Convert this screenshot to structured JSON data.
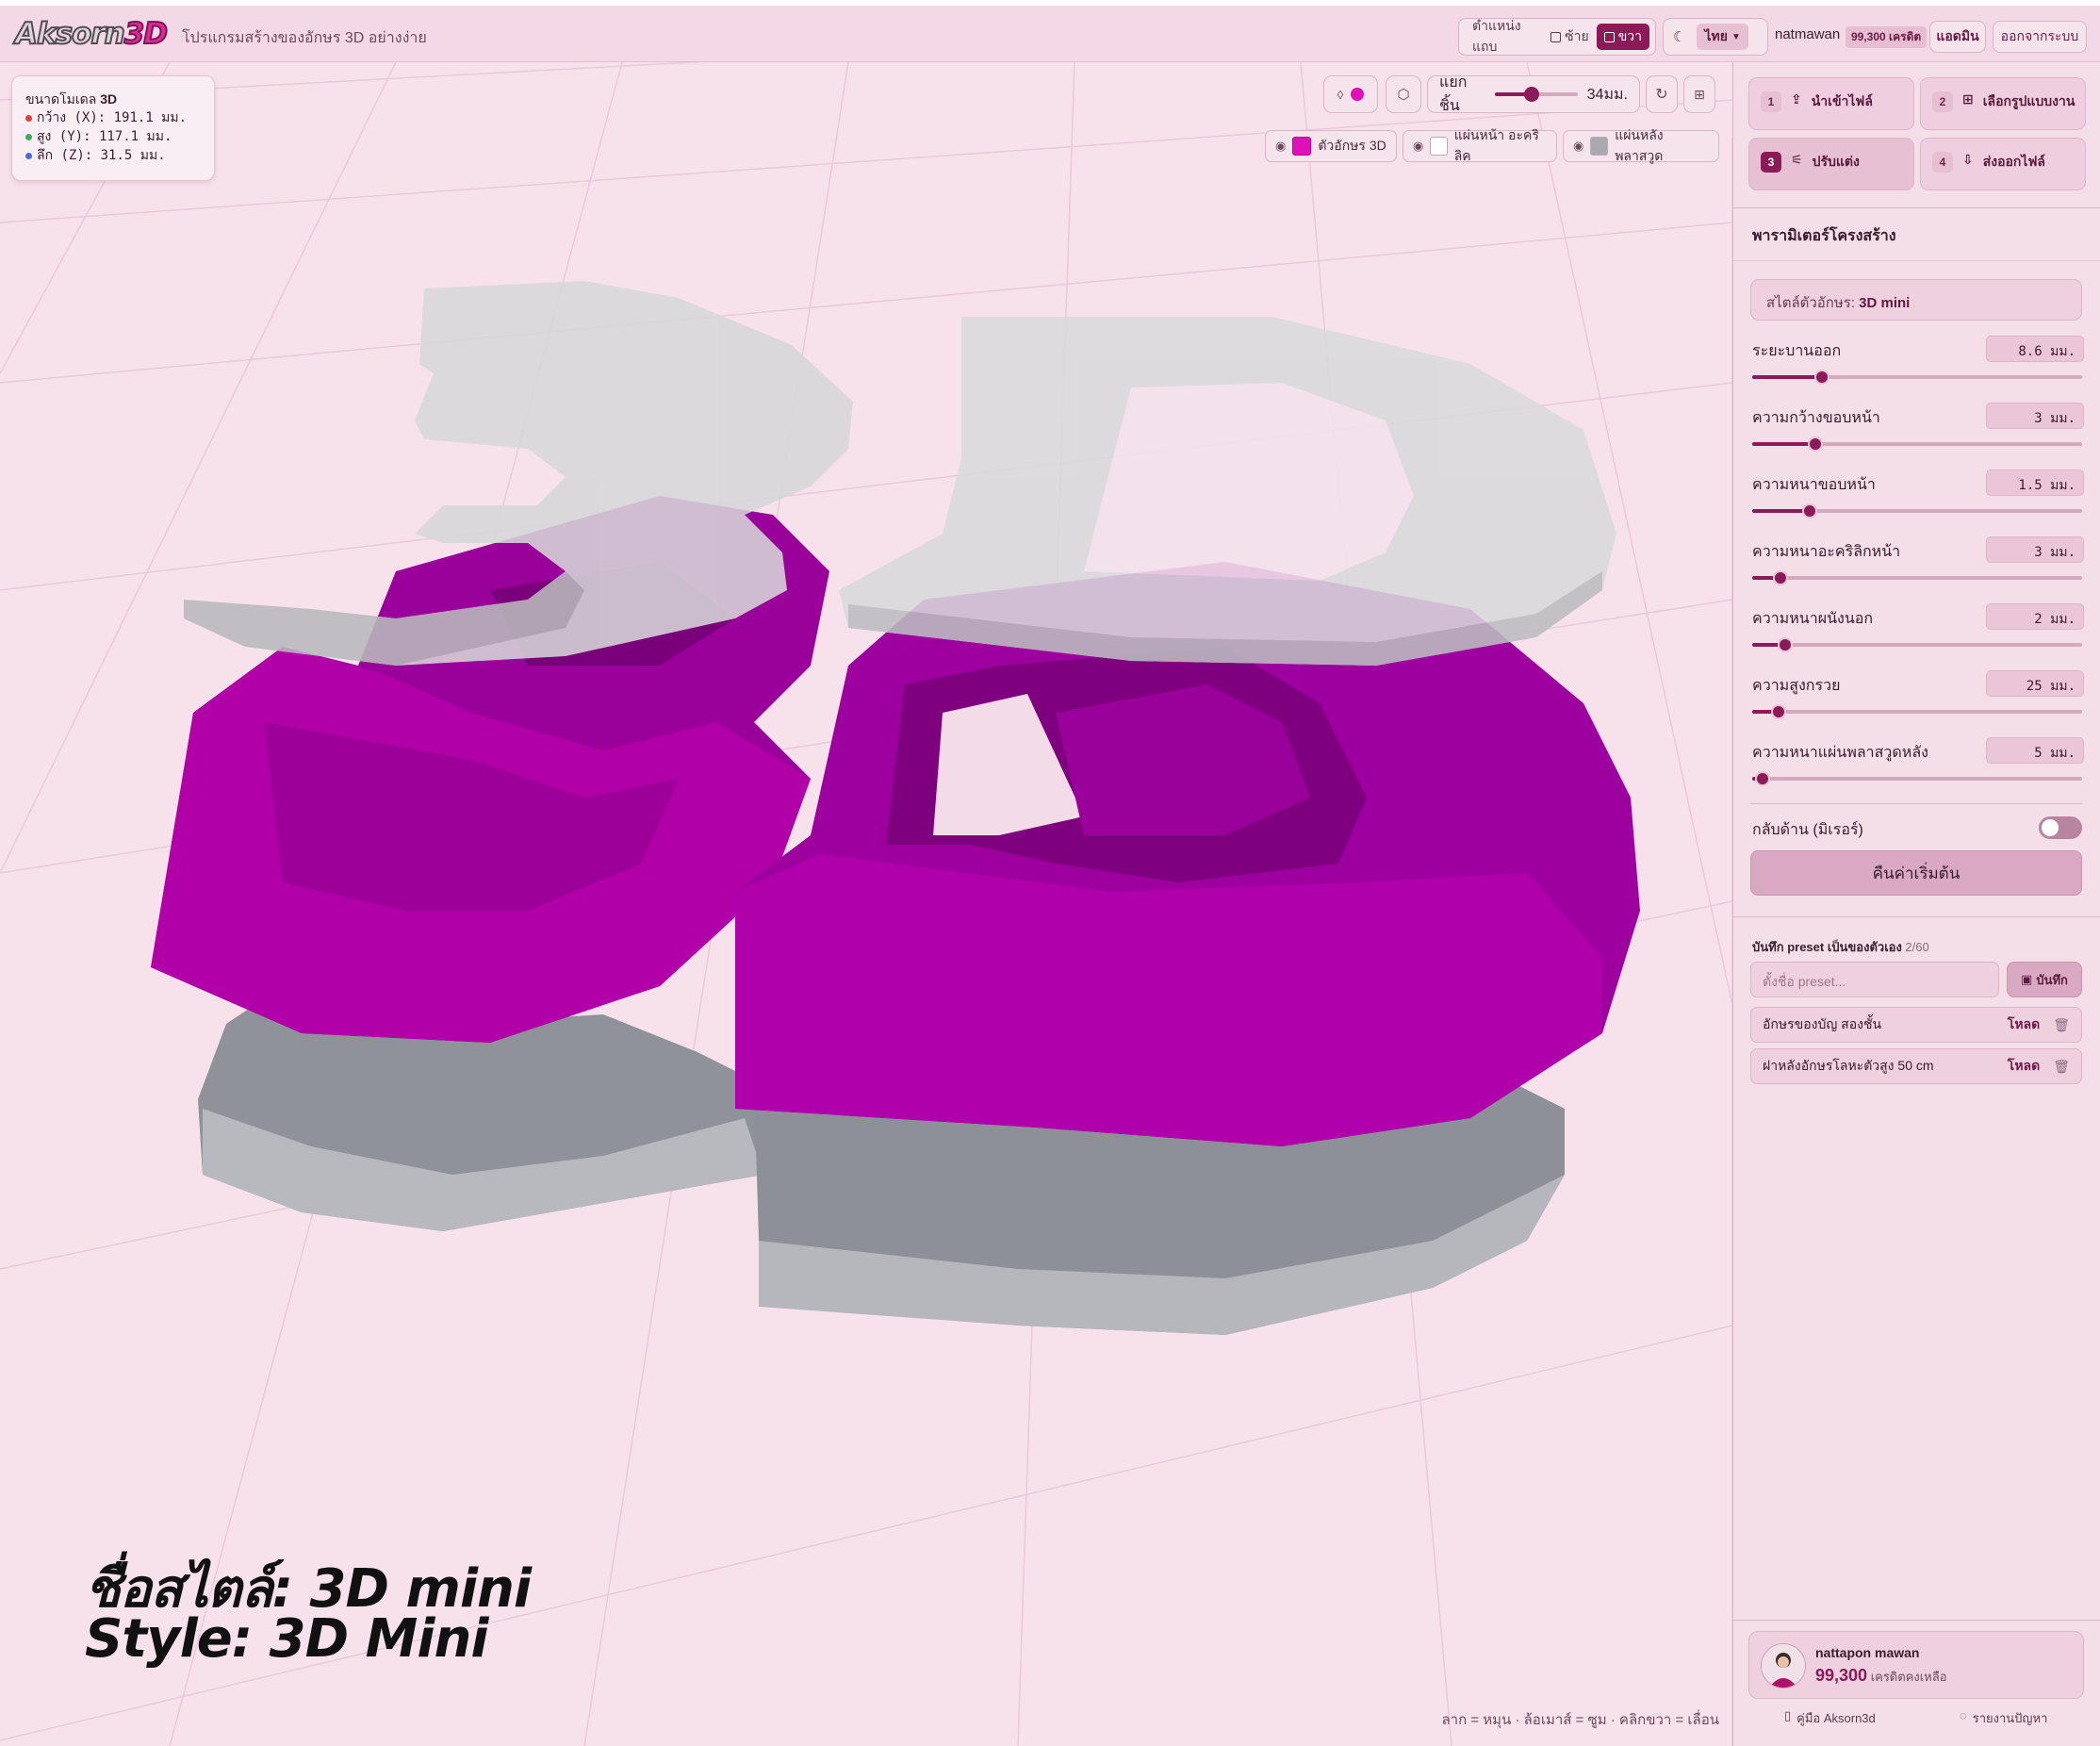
{
  "app": {
    "logo_text": "Aksorn",
    "logo_accent": "3D",
    "tagline": "โปรแกรมสร้างของอักษร 3D อย่างง่าย"
  },
  "topbar": {
    "panel_position_label": "ตำแหน่งแถบ",
    "left_label": "ซ้าย",
    "right_label": "ขวา",
    "language": "ไทย",
    "username": "natmawan",
    "credits_badge": "99,300 เครดิต",
    "admin_label": "แอดมิน",
    "logout_label": "ออกจากระบบ"
  },
  "viewport": {
    "dimensions": {
      "title": "ขนาดโมเดล",
      "title_value": "3D",
      "width": "กว้าง (X): 191.1 มม.",
      "height": "สูง (Y): 117.1 มม.",
      "depth": "ลึก (Z): 31.5 มม."
    },
    "explode_label": "แยกชิ้น",
    "explode_value": "34มม.",
    "explode_fraction": 0.45,
    "layers": [
      {
        "label": "ตัวอักษร 3D",
        "color": "#e010b8"
      },
      {
        "label": "แผ่นหน้า อะคริลิค",
        "color": "#ffffff"
      },
      {
        "label": "แผ่นหลัง พลาสวูด",
        "color": "#a8aab0"
      }
    ],
    "caption_line1": "ชื่อสไตล์: 3D mini",
    "caption_line2": "Style: 3D Mini",
    "controls_hint": "ลาก = หมุน · ล้อเมาส์ = ซูม · คลิกขวา = เลื่อน",
    "model_text": "3D"
  },
  "steps": [
    {
      "num": "1",
      "label": "นำเข้าไฟล์"
    },
    {
      "num": "2",
      "label": "เลือกรูปแบบงาน"
    },
    {
      "num": "3",
      "label": "ปรับแต่ง"
    },
    {
      "num": "4",
      "label": "ส่งออกไฟล์"
    }
  ],
  "params": {
    "section_title": "พารามิเตอร์โครงสร้าง",
    "style_prefix": "สไตล์ตัวอักษร:",
    "style_name": "3D mini",
    "items": [
      {
        "label": "ระยะบานออก",
        "value": "8.6 มม.",
        "fraction": 0.21
      },
      {
        "label": "ความกว้างขอบหน้า",
        "value": "3 มม.",
        "fraction": 0.19
      },
      {
        "label": "ความหนาขอบหน้า",
        "value": "1.5 มม.",
        "fraction": 0.175
      },
      {
        "label": "ความหนาอะคริลิกหน้า",
        "value": "3 มม.",
        "fraction": 0.085
      },
      {
        "label": "ความหนาผนังนอก",
        "value": "2 มม.",
        "fraction": 0.1
      },
      {
        "label": "ความสูงกรวย",
        "value": "25 มม.",
        "fraction": 0.08
      },
      {
        "label": "ความหนาแผ่นพลาสวูดหลัง",
        "value": "5 มม.",
        "fraction": 0.03
      }
    ],
    "mirror_label": "กลับด้าน (มิเรอร์)",
    "reset_label": "คืนค่าเริ่มต้น"
  },
  "presets": {
    "title": "บันทึก preset เป็นของตัวเอง",
    "count": "2/60",
    "placeholder": "ตั้งชื่อ preset...",
    "save_label": "บันทึก",
    "load_label": "โหลด",
    "items": [
      {
        "name": "อักษรของบัญ สองชั้น"
      },
      {
        "name": "ฝาหลังอักษรโลหะตัวสูง 50 cm"
      }
    ]
  },
  "user_card": {
    "name": "nattapon mawan",
    "credits": "99,300",
    "credits_label": "เครดิตคงเหลือ"
  },
  "footer": {
    "manual_label": "คู่มือ Aksorn3d",
    "report_label": "รายงานปัญหา"
  }
}
